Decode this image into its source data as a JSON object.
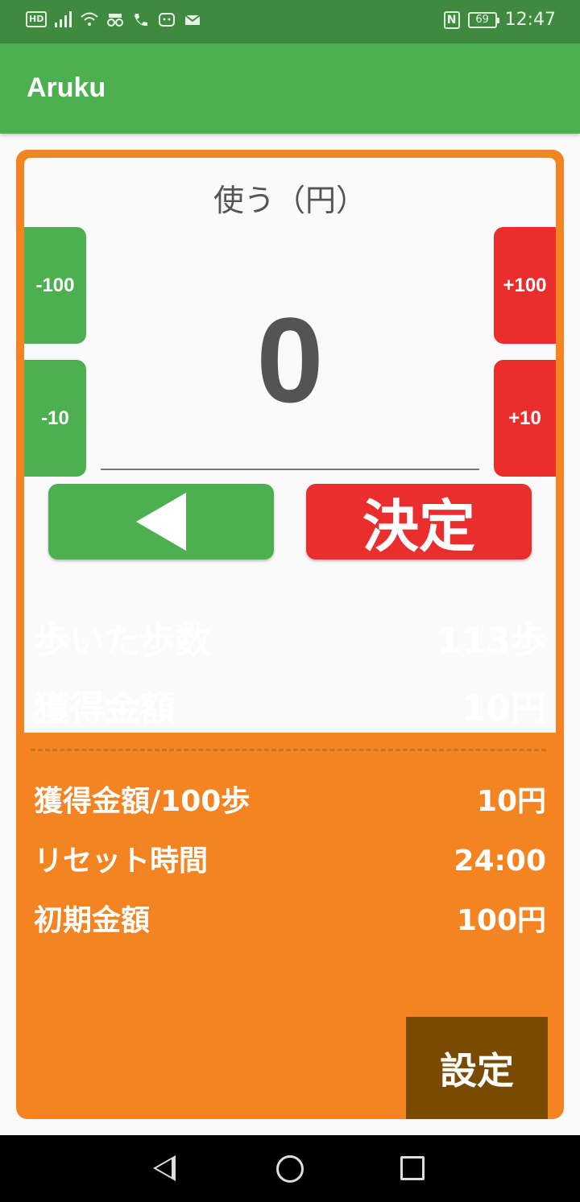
{
  "status_bar": {
    "left_badge": "HD",
    "icons": [
      "signal-icon",
      "wifi-icon",
      "incognito-icon",
      "call-icon",
      "face-icon",
      "mail-icon"
    ],
    "nfc_label": "N",
    "battery": "69",
    "time": "12:47"
  },
  "app_bar": {
    "title": "Aruku"
  },
  "use_panel": {
    "title": "使う（円）",
    "amount": "0",
    "minus_100": "-100",
    "minus_10": "-10",
    "plus_100": "+100",
    "plus_10": "+10",
    "confirm_label": "決定",
    "back_icon": "back-triangle-icon"
  },
  "stats": {
    "steps_label": "歩いた歩数",
    "steps_value": "113歩",
    "earned_label": "獲得金額",
    "earned_value": "10円",
    "rate_label": "獲得金額/100歩",
    "rate_value": "10円",
    "reset_label": "リセット時間",
    "reset_value": "24:00",
    "initial_label": "初期金額",
    "initial_value": "100円"
  },
  "settings_label": "設定",
  "colors": {
    "status_bar": "#3f8a3f",
    "app_bar": "#4caf50",
    "card": "#f38421",
    "green_button": "#4caf50",
    "red_button": "#ea2d2d",
    "settings_button": "#7a4a00"
  }
}
